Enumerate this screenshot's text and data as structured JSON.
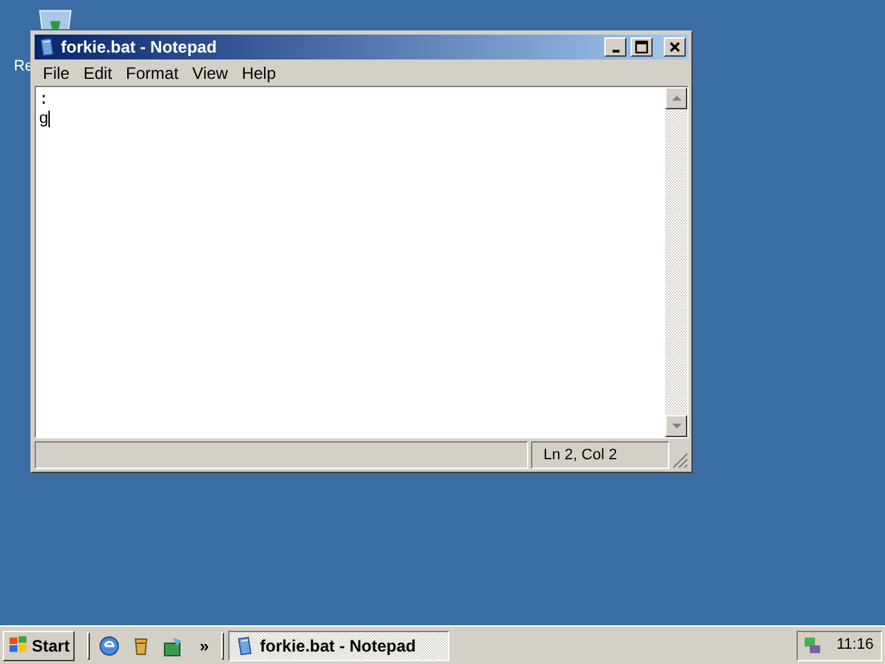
{
  "desktop": {
    "icons": [
      {
        "label": "Re"
      }
    ]
  },
  "window": {
    "title": "forkie.bat - Notepad",
    "menu": [
      "File",
      "Edit",
      "Format",
      "View",
      "Help"
    ],
    "text_lines": [
      ":",
      "g"
    ],
    "status_bar": {
      "position": "Ln 2, Col 2"
    }
  },
  "taskbar": {
    "start": "Start",
    "chevron": "»",
    "tasks": [
      {
        "label": "forkie.bat - Notepad",
        "selected": true
      }
    ],
    "clock": "11:16"
  }
}
